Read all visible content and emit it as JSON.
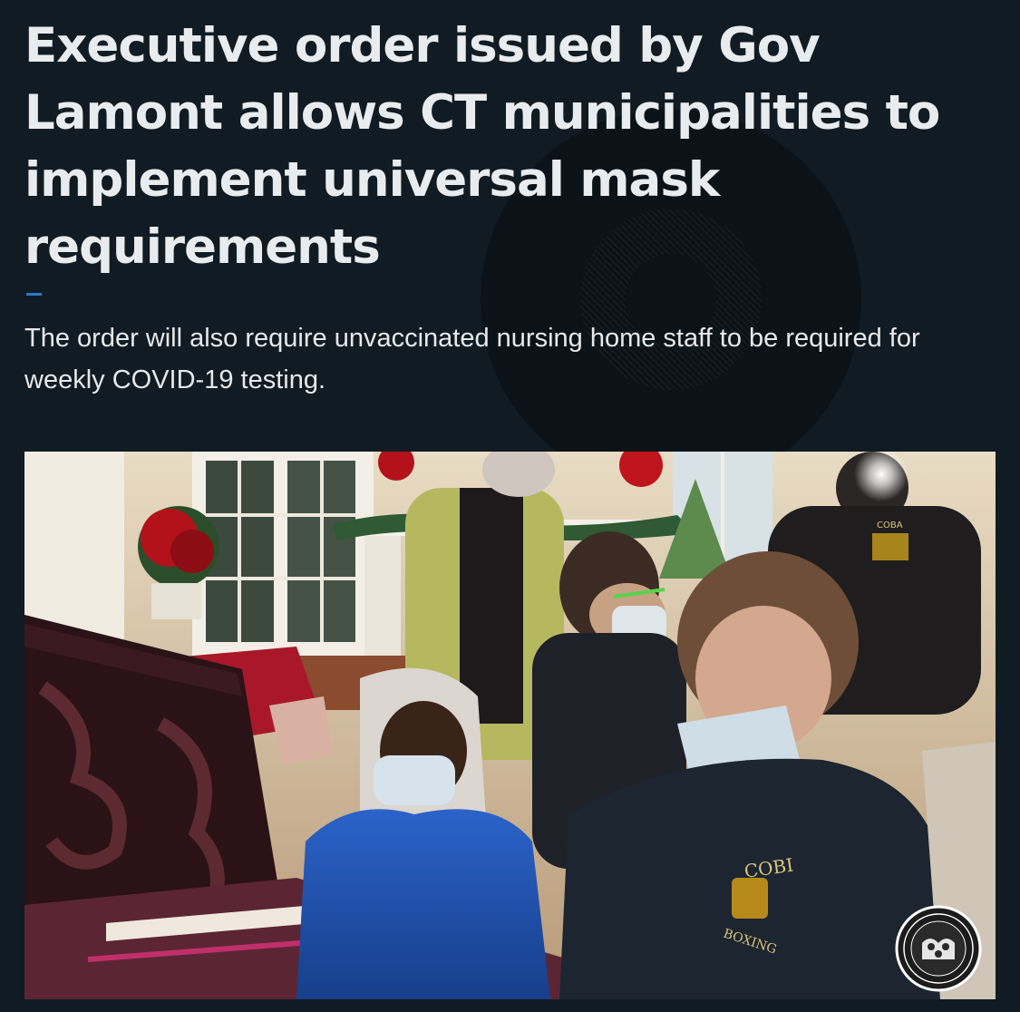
{
  "article": {
    "headline": "Executive order issued by Gov Lamont allows CT municipalities to implement universal mask requirements",
    "dek": "The order will also require unvaccinated nursing home staff to be required for weekly COVID-19 testing."
  },
  "photo": {
    "jacket_text_1": "COBI",
    "jacket_text_2": "BOXING",
    "jacket_text_3": "COBA"
  },
  "colors": {
    "background": "#111b23",
    "headline": "#e9ecee",
    "accent": "#2f79c7"
  }
}
